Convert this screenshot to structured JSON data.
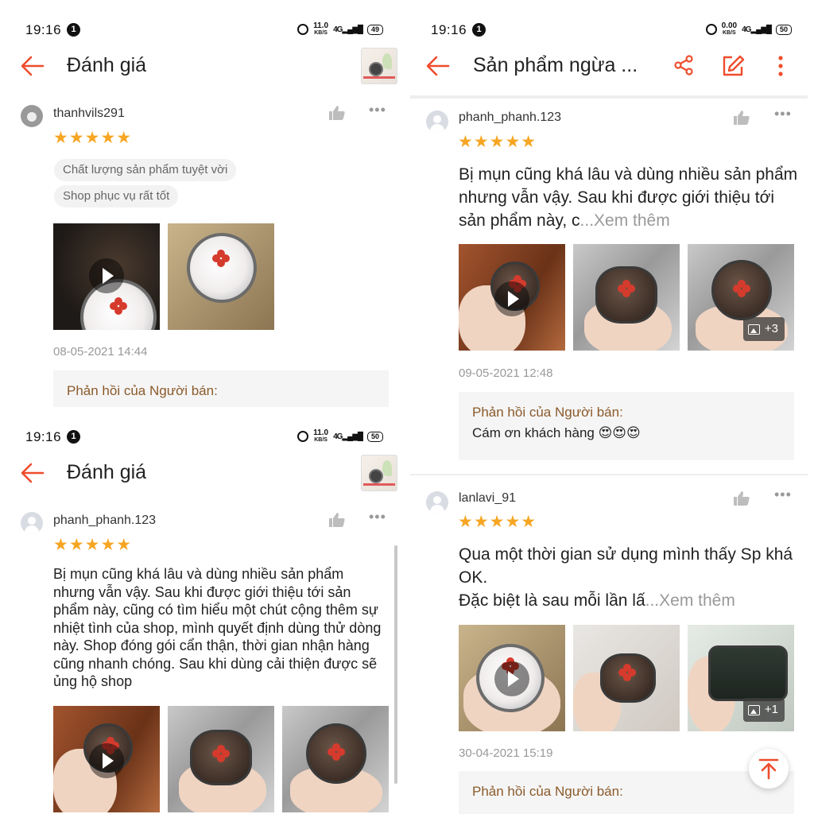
{
  "colors": {
    "accent": "#ee4d2d",
    "star": "#f6a623",
    "seller_label": "#8b5a2b",
    "muted": "#999999"
  },
  "panel1": {
    "status": {
      "time": "19:16",
      "notif": "1",
      "speed": "11.0",
      "speed_unit": "KB/S",
      "network": "4G",
      "battery": "49"
    },
    "title": "Đánh giá",
    "review": {
      "username": "thanhvils291",
      "stars": "★★★★★",
      "tags": [
        "Chất lượng sản phẩm tuyệt vời",
        "Shop phục vụ rất tốt"
      ],
      "date": "08-05-2021 14:44",
      "reply_label": "Phản hồi của Người bán:"
    }
  },
  "panel2": {
    "status": {
      "time": "19:16",
      "notif": "1",
      "speed": "11.0",
      "speed_unit": "KB/S",
      "network": "4G",
      "battery": "50"
    },
    "title": "Đánh giá",
    "review": {
      "username": "phanh_phanh.123",
      "stars": "★★★★★",
      "text": "Bị mụn cũng khá lâu và dùng nhiều sản phẩm nhưng vẫn vậy. Sau khi được giới thiệu tới sản phẩm này, cũng có tìm hiểu một chút cộng thêm sự nhiệt tình của shop, mình quyết định dùng thử dòng này. Shop đóng gói cẩn thận, thời gian nhận hàng cũng nhanh chóng. Sau khi dùng cải thiện được sẽ ủng hộ shop"
    }
  },
  "panel3": {
    "status": {
      "time": "19:16",
      "notif": "1",
      "speed": "0.00",
      "speed_unit": "KB/S",
      "network": "4G",
      "battery": "50"
    },
    "title": "Sản phẩm ngừa ...",
    "reviews": [
      {
        "username": "phanh_phanh.123",
        "stars": "★★★★★",
        "text": "Bị mụn cũng khá lâu và dùng nhiều sản phẩm nhưng vẫn vậy. Sau khi được giới  thiệu tới sản phẩm này, c",
        "see_more": "...Xem thêm",
        "more_images": "+3",
        "date": "09-05-2021 12:48",
        "reply_label": "Phản hồi của Người bán:",
        "reply_text": "Cám ơn khách hàng 😍😍😍"
      },
      {
        "username": "lanlavi_91",
        "stars": "★★★★★",
        "text_line1": "Qua một thời gian sử dụng mình thấy Sp khá OK.",
        "text_line2": "Đặc biệt là sau mỗi lần lấ",
        "see_more": "...Xem thêm",
        "more_images": "+1",
        "date": "30-04-2021 15:19",
        "reply_label": "Phản hồi của Người bán:"
      }
    ]
  },
  "icons": {
    "back": "arrow-left-icon",
    "like": "thumbs-up-icon",
    "more": "more-horizontal-icon",
    "share": "share-icon",
    "edit": "edit-icon",
    "menu": "more-vertical-icon",
    "scroll_top": "arrow-up-icon"
  }
}
